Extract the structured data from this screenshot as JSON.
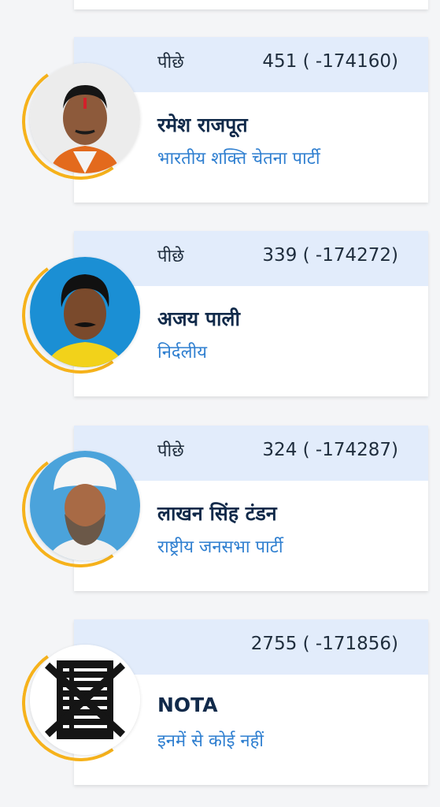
{
  "candidates": [
    {
      "status": "पीछे",
      "votes": "451 ( -174160)",
      "name": "रमेश राजपूत",
      "party": "भारतीय शक्ति चेतना पार्टी",
      "photo_icon": "candidate-photo"
    },
    {
      "status": "पीछे",
      "votes": "339 ( -174272)",
      "name": "अजय पाली",
      "party": "निर्दलीय",
      "photo_icon": "candidate-photo"
    },
    {
      "status": "पीछे",
      "votes": "324 ( -174287)",
      "name": "लाखन सिंह टंडन",
      "party": "राष्ट्रीय जनसभा पार्टी",
      "photo_icon": "candidate-photo"
    },
    {
      "status": "",
      "votes": "2755 ( -171856)",
      "name": "NOTA",
      "party": "इनमें से कोई नहीं",
      "photo_icon": "nota-symbol-icon"
    }
  ],
  "colors": {
    "header_bg": "#e2ecfb",
    "party_text": "#2f7fd0",
    "name_text": "#112a4a",
    "ring_accent": "#f6b21b"
  }
}
